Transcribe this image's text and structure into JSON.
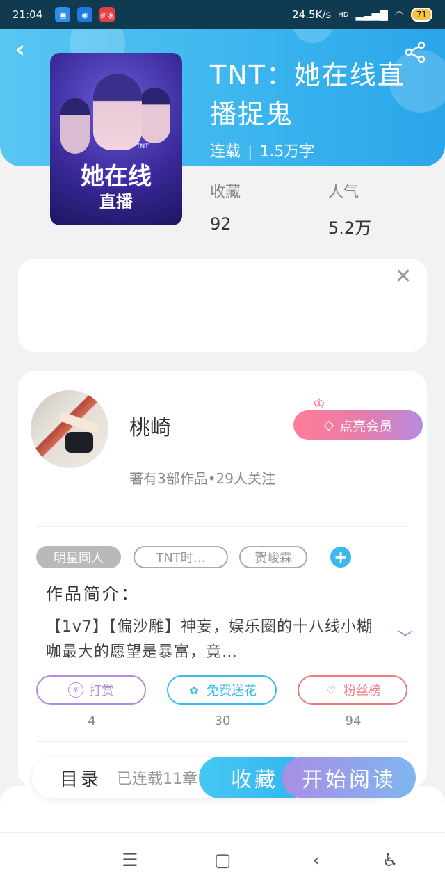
{
  "status_bar": {
    "time": "21:04",
    "network_speed": "24.5K/s",
    "network_type": "HD",
    "battery": "71",
    "app_icons": [
      "app-icon-blue",
      "app-icon-signal",
      "新浪"
    ]
  },
  "header": {
    "back_icon": "back-arrow-icon",
    "share_icon": "share-icon"
  },
  "book": {
    "cover": {
      "title": "她在线",
      "subtitle": "直播",
      "label": "TNT"
    },
    "title": "TNT：她在线直播捉鬼",
    "status": "连载",
    "word_count": "1.5万字",
    "stats": [
      {
        "label": "收藏",
        "value": "92"
      },
      {
        "label": "人气",
        "value": "5.2万"
      }
    ]
  },
  "ad": {
    "close_icon": "close-icon"
  },
  "author": {
    "name": "桃崎",
    "info": "著有3部作品•29人关注",
    "vip_label": "点亮会员"
  },
  "tags": [
    "明星同人",
    "TNT时…",
    "贺峻霖"
  ],
  "intro": {
    "title": "作品简介：",
    "text": "【1v7】【偏沙雕】神妄，娱乐圈的十八线小糊咖最大的愿望是暴富，竟…"
  },
  "actions": [
    {
      "label": "打赏",
      "count": "4",
      "color": "#b48ae0"
    },
    {
      "label": "免费送花",
      "count": "30",
      "color": "#3cbcec"
    },
    {
      "label": "粉丝榜",
      "count": "94",
      "color": "#ef7c7c"
    }
  ],
  "bottom": {
    "toc_label": "目录",
    "toc_status": "已连载11章",
    "collect_label": "收藏",
    "read_label": "开始阅读"
  },
  "colors": {
    "header_blue": "#3ab4ee",
    "accent_purple": "#b48ae0"
  }
}
